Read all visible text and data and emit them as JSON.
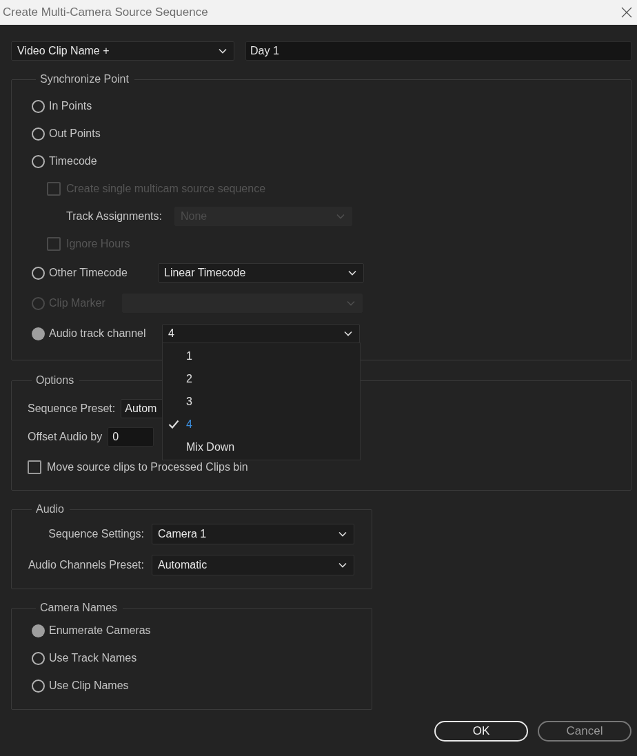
{
  "window": {
    "title": "Create Multi-Camera Source Sequence"
  },
  "naming": {
    "preset": "Video Clip Name +",
    "value": "Day 1"
  },
  "synchronize_point": {
    "title": "Synchronize Point",
    "items": [
      {
        "kind": "radio",
        "label": "In Points",
        "selected": false,
        "disabled": false
      },
      {
        "kind": "radio",
        "label": "Out Points",
        "selected": false,
        "disabled": false
      },
      {
        "kind": "radio",
        "label": "Timecode",
        "selected": false,
        "disabled": false
      },
      {
        "kind": "checkbox",
        "label": "Create single multicam source sequence",
        "checked": false,
        "disabled": true
      },
      {
        "kind": "select",
        "label": "Track Assignments:",
        "value": "None",
        "disabled": true
      },
      {
        "kind": "checkbox",
        "label": "Ignore Hours",
        "checked": false,
        "disabled": true
      },
      {
        "kind": "radio",
        "label": "Other Timecode",
        "selected": false,
        "disabled": false,
        "dropdown": {
          "value": "Linear Timecode",
          "disabled": false
        }
      },
      {
        "kind": "radio",
        "label": "Clip Marker",
        "selected": false,
        "disabled": true,
        "dropdown": {
          "disabled": true
        }
      },
      {
        "kind": "radio",
        "label": "Audio track channel",
        "selected": true,
        "disabled": false,
        "dropdown": {
          "value": "4",
          "disabled": false,
          "menu": [
            {
              "label": "1",
              "selected": false
            },
            {
              "label": "2",
              "selected": false
            },
            {
              "label": "3",
              "selected": false
            },
            {
              "label": "4",
              "selected": true
            },
            {
              "label": "Mix Down",
              "selected": false
            }
          ]
        }
      }
    ]
  },
  "options": {
    "title": "Options",
    "sequence_preset": {
      "label": "Sequence Preset:",
      "value": "Autom"
    },
    "offset_audio": {
      "label": "Offset Audio by",
      "value": "0"
    },
    "move_clips": {
      "label": "Move source clips to Processed Clips bin",
      "checked": false
    }
  },
  "audio": {
    "title": "Audio",
    "rows": [
      {
        "label": "Sequence Settings:",
        "value": "Camera 1"
      },
      {
        "label": "Audio Channels Preset:",
        "value": "Automatic"
      }
    ]
  },
  "camera_names": {
    "title": "Camera Names",
    "options": [
      {
        "label": "Enumerate Cameras",
        "selected": true
      },
      {
        "label": "Use Track Names",
        "selected": false
      },
      {
        "label": "Use Clip Names",
        "selected": false
      }
    ]
  },
  "buttons": [
    {
      "label": "OK",
      "kind": "default"
    },
    {
      "label": "Cancel",
      "kind": "normal"
    }
  ]
}
